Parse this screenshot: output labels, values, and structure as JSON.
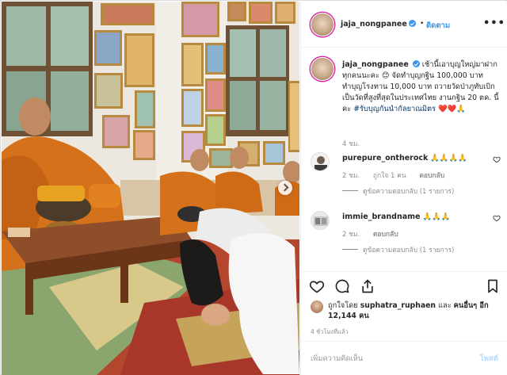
{
  "header": {
    "username": "jaja_nongpanee",
    "separator": "•",
    "follow_label": "ติดตาม",
    "more_label": "•••"
  },
  "caption": {
    "username": "jaja_nongpanee",
    "text": "เช้านี้เอาบุญใหญ่มาฝากทุกคนนะคะ 😊 จัดทำบุญกฐิน 100,000 บาท ทำบุญโรงทาน 10,000 บาท ถวายวัดป่าภูทับเบิก เป็นวัดที่สูงที่สุดในประเทศไทย งานกฐิน 20 ตค. นี้คะ",
    "hashtag": "#รับบุญกันนำกัลยาณมิตร",
    "emoji_tail": "❤️❤️🙏",
    "time": "4 ชม."
  },
  "comments": [
    {
      "username": "purepure_ontherock",
      "text": "🙏🙏🙏🙏",
      "time": "2 ชม.",
      "likes": "ถูกใจ 1 คน",
      "reply_label": "ตอบกลับ",
      "view_replies": "ดูข้อความตอบกลับ (1 รายการ)"
    },
    {
      "username": "immie_brandname",
      "text": "🙏🙏🙏",
      "time": "2 ชม.",
      "likes": "",
      "reply_label": "ตอบกลับ",
      "view_replies": "ดูข้อความตอบกลับ (1 รายการ)"
    }
  ],
  "likes": {
    "prefix": "ถูกใจโดย",
    "user": "suphatra_ruphaen",
    "and": "และ",
    "others": "คนอื่นๆ อีก 12,144 คน"
  },
  "post_time": "4 ชั่วโมงที่แล้ว",
  "add_comment": {
    "placeholder": "เพิ่มความคิดเห็น",
    "post_label": "โพสต์"
  },
  "colors": {
    "link_blue": "#3897f0",
    "post_disabled": "#b3dbff",
    "muted": "#8e8e8e"
  }
}
